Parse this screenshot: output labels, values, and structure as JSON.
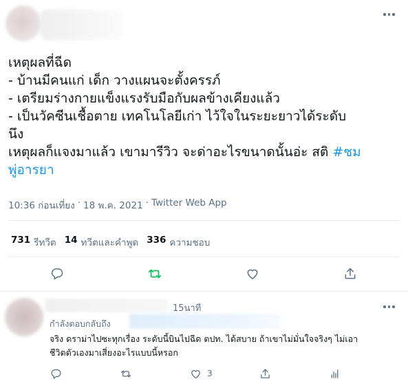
{
  "tweet": {
    "lines": [
      "เหตุผลที่ฉีด",
      "- บ้านมีคนแก่ เด็ก วางแผนจะตั้งครรภ์",
      "- เตรียมร่างกายแข็งแรงรับมือกับผลข้างเคียงแล้ว",
      "- เป็นวัคซีนเชื้อตาย เทคโนโลยีเก่า ไว้ใจในระยะยาวได้ระดับ",
      "นึง"
    ],
    "line6_text": "เหตุผลก็แจงมาแล้ว เขามารีวิว จะด่าอะไรขนาดนั้นอ่ะ สติ ",
    "hashtag_part1": "#ชม",
    "hashtag_part2": "พู่อารยา",
    "time": "10:36 ก่อนเที่ยง",
    "date": "18 พ.ค. 2021",
    "separator": "·",
    "source": "Twitter Web App",
    "stats": {
      "retweets_count": "731",
      "retweets_label": "รีทวีต",
      "quotes_count": "14",
      "quotes_label": "ทวีตและคำพูด",
      "likes_count": "336",
      "likes_label": "ความชอบ"
    }
  },
  "reply": {
    "time": "15นาที",
    "replying_label": "กำลังตอบกลับถึง",
    "lines": [
      "จริง ดราม่าไปซะทุกเรื่อง ระดับนี้บินไปฉีด ตปท. ได้สบาย ถ้าเขาไม่มั่นใจจริงๆ ไม่เอา",
      "ชีวิตตัวเองมาเสี่ยงอะไรแบบนี้หรอก"
    ],
    "like_count": "3"
  },
  "icons": {
    "more": "more-icon",
    "reply": "reply-icon",
    "retweet": "retweet-icon",
    "like": "like-icon",
    "share": "share-icon",
    "analytics": "analytics-icon"
  },
  "colors": {
    "retweet_active": "#17bf63",
    "link": "#1b95e0",
    "secondary_text": "#5b7083"
  }
}
